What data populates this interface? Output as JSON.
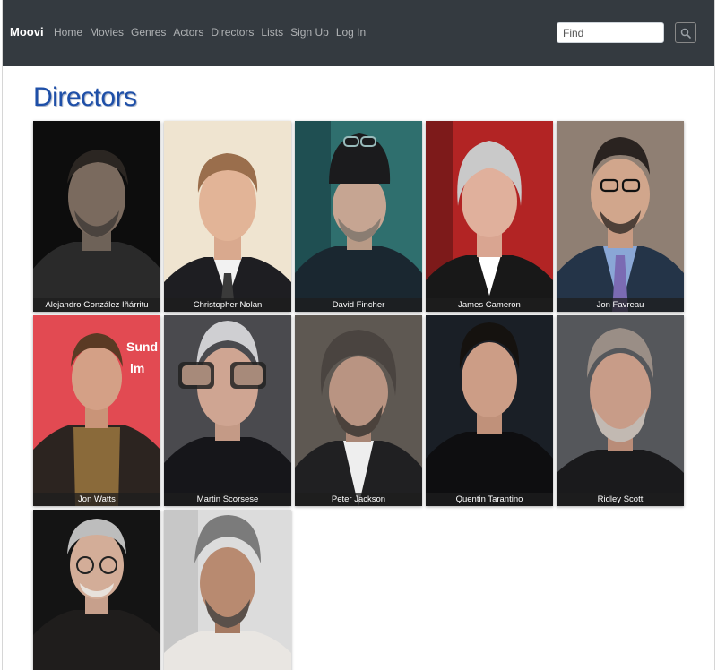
{
  "nav": {
    "brand": "Moovi",
    "links": [
      "Home",
      "Movies",
      "Genres",
      "Actors",
      "Directors",
      "Lists",
      "Sign Up",
      "Log In"
    ],
    "search_placeholder": "Find"
  },
  "page": {
    "title": "Directors"
  },
  "directors": [
    "Alejandro González Iñárritu",
    "Christopher Nolan",
    "David Fincher",
    "James Cameron",
    "Jon Favreau",
    "Jon Watts",
    "Martin Scorsese",
    "Peter Jackson",
    "Quentin Tarantino",
    "Ridley Scott",
    "",
    ""
  ],
  "colors": {
    "navbar": "#343a40",
    "title": "#1e4fa8"
  }
}
